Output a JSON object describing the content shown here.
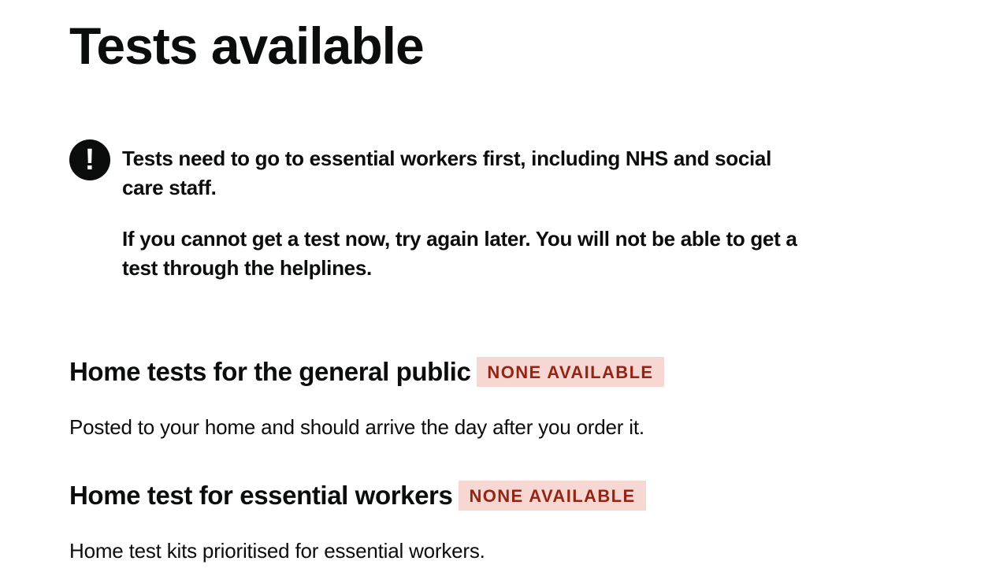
{
  "page": {
    "title": "Tests available"
  },
  "warning": {
    "icon": "exclamation-icon",
    "icon_glyph": "!",
    "paragraphs": [
      "Tests need to go to essential workers first, including NHS and social care staff.",
      "If you cannot get a test now, try again later. You will not be able to get a test through the helplines."
    ]
  },
  "tests": [
    {
      "heading": "Home tests for the general public",
      "status": "NONE AVAILABLE",
      "description": "Posted to your home and should arrive the day after you order it."
    },
    {
      "heading": "Home test for essential workers",
      "status": "NONE AVAILABLE",
      "description": "Home test kits prioritised for essential workers."
    }
  ],
  "colors": {
    "text": "#0b0c0c",
    "tag_background": "#f6d7d2",
    "tag_text": "#942514"
  }
}
